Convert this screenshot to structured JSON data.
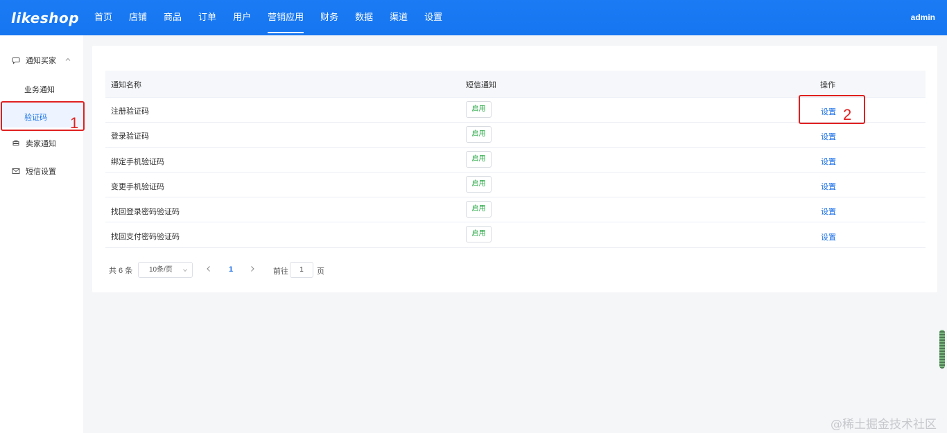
{
  "app": {
    "logo": "likeshop",
    "user": "admin"
  },
  "nav": [
    "首页",
    "店铺",
    "商品",
    "订单",
    "用户",
    "营销应用",
    "财务",
    "数据",
    "渠道",
    "设置"
  ],
  "nav_active": "营销应用",
  "sidebar": {
    "group": "通知买家",
    "items": [
      "业务通知",
      "验证码"
    ],
    "active": "验证码",
    "others": [
      "卖家通知",
      "短信设置"
    ]
  },
  "table": {
    "headers": [
      "通知名称",
      "短信通知",
      "操作"
    ],
    "rows": [
      {
        "name": "注册验证码",
        "status": "启用",
        "action": "设置"
      },
      {
        "name": "登录验证码",
        "status": "启用",
        "action": "设置"
      },
      {
        "name": "绑定手机验证码",
        "status": "启用",
        "action": "设置"
      },
      {
        "name": "变更手机验证码",
        "status": "启用",
        "action": "设置"
      },
      {
        "name": "找回登录密码验证码",
        "status": "启用",
        "action": "设置"
      },
      {
        "name": "找回支付密码验证码",
        "status": "启用",
        "action": "设置"
      }
    ]
  },
  "pagination": {
    "total": "共 6 条",
    "page_size": "10条/页",
    "current": "1",
    "goto_label": "前往",
    "goto_value": "1",
    "page_label": "页"
  },
  "annotations": [
    "1",
    "2"
  ],
  "watermark": "@稀土掘金技术社区",
  "colors": {
    "primary": "#1677ff",
    "link": "#1a6fe8",
    "enabled": "#28a745",
    "annotation": "#e02020"
  }
}
